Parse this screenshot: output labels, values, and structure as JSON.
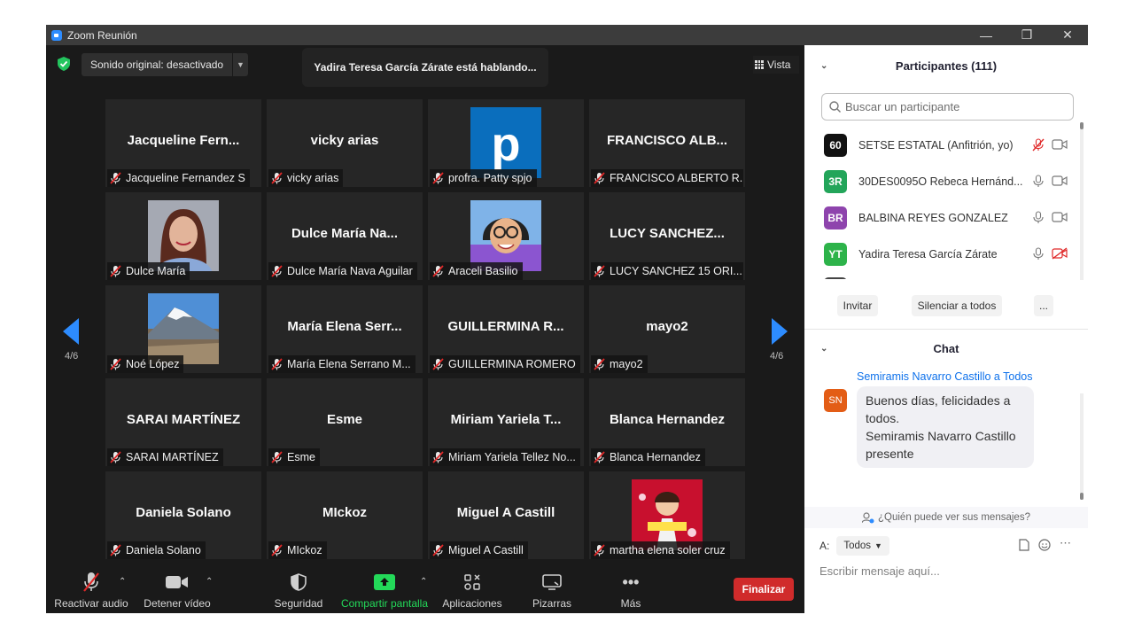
{
  "window": {
    "title": "Zoom Reunión"
  },
  "topbar": {
    "sound_select": "Sonido original: desactivado",
    "speaking_banner": "Yadira Teresa García Zárate está hablando...",
    "view_label": "Vista"
  },
  "pagination": {
    "left": "4/6",
    "right": "4/6"
  },
  "tiles": [
    {
      "big": "Jacqueline  Fern...",
      "label": "Jacqueline Fernandez S",
      "image": ""
    },
    {
      "big": "vicky arias",
      "label": "vicky arias",
      "image": ""
    },
    {
      "big": "",
      "label": "profra. Patty spjo",
      "image": "letter-p"
    },
    {
      "big": "FRANCISCO  ALB...",
      "label": "FRANCISCO ALBERTO R...",
      "image": ""
    },
    {
      "big": "",
      "label": "Dulce María",
      "image": "photo-woman"
    },
    {
      "big": "Dulce  María  Na...",
      "label": "Dulce María Nava Aguilar",
      "image": ""
    },
    {
      "big": "",
      "label": "Araceli Basilio",
      "image": "cartoon-avatar"
    },
    {
      "big": "LUCY  SANCHEZ...",
      "label": "LUCY SANCHEZ  15 ORI...",
      "image": ""
    },
    {
      "big": "",
      "label": "Noé López",
      "image": "photo-volcano"
    },
    {
      "big": "María  Elena  Serr...",
      "label": "María Elena Serrano M...",
      "image": ""
    },
    {
      "big": "GUILLERMINA  R...",
      "label": "GUILLERMINA ROMERO",
      "image": ""
    },
    {
      "big": "mayo2",
      "label": "mayo2",
      "image": ""
    },
    {
      "big": "SARAI  MARTÍNEZ",
      "label": "SARAI MARTÍNEZ",
      "image": ""
    },
    {
      "big": "Esme",
      "label": "Esme",
      "image": ""
    },
    {
      "big": "Miriam  Yariela  T...",
      "label": "Miriam Yariela Tellez No...",
      "image": ""
    },
    {
      "big": "Blanca  Hernandez",
      "label": "Blanca Hernandez",
      "image": ""
    },
    {
      "big": "Daniela  Solano",
      "label": "Daniela Solano",
      "image": ""
    },
    {
      "big": "MIckoz",
      "label": "MIckoz",
      "image": ""
    },
    {
      "big": "Miguel  A  Castill",
      "label": "Miguel A Castill",
      "image": ""
    },
    {
      "big": "",
      "label": "martha elena soler cruz",
      "image": "cartoon-girl"
    }
  ],
  "toolbar": {
    "unmute": "Reactivar audio",
    "stop_video": "Detener vídeo",
    "security": "Seguridad",
    "share": "Compartir pantalla",
    "apps": "Aplicaciones",
    "whiteboards": "Pizarras",
    "more": "Más",
    "end": "Finalizar"
  },
  "participants": {
    "header": "Participantes (111)",
    "search_placeholder": "Buscar un participante",
    "list": [
      {
        "initials": "60",
        "name": "SETSE ESTATAL (Anfitrión, yo)",
        "color": "#111111",
        "mic": "muted",
        "cam": "off"
      },
      {
        "initials": "3R",
        "name": "30DES0095O  Rebeca Hernánd...",
        "color": "#23a55a",
        "mic": "on",
        "cam": "off"
      },
      {
        "initials": "BR",
        "name": "BALBINA REYES GONZALEZ",
        "color": "#8e44ad",
        "mic": "on",
        "cam": "off"
      },
      {
        "initials": "YT",
        "name": "Yadira Teresa García Zárate",
        "color": "#2db34a",
        "mic": "on",
        "cam": "muted"
      }
    ],
    "invite": "Invitar",
    "mute_all": "Silenciar a todos",
    "more": "..."
  },
  "chat": {
    "header": "Chat",
    "from_name": "Semiramis Navarro Castillo",
    "to_word": "a",
    "to_target": "Todos",
    "avatar": "SN",
    "message_line1": "Buenos días, felicidades a todos.",
    "message_line2": "Semiramis Navarro Castillo presente",
    "who_can_see": "¿Quién puede ver sus mensajes?",
    "to_label": "A:",
    "to_select": "Todos",
    "compose_placeholder": "Escribir mensaje aquí..."
  },
  "colors": {
    "accent": "#2d8cff",
    "end": "#d02b2b",
    "share": "#23d959",
    "muted": "#e02828"
  }
}
